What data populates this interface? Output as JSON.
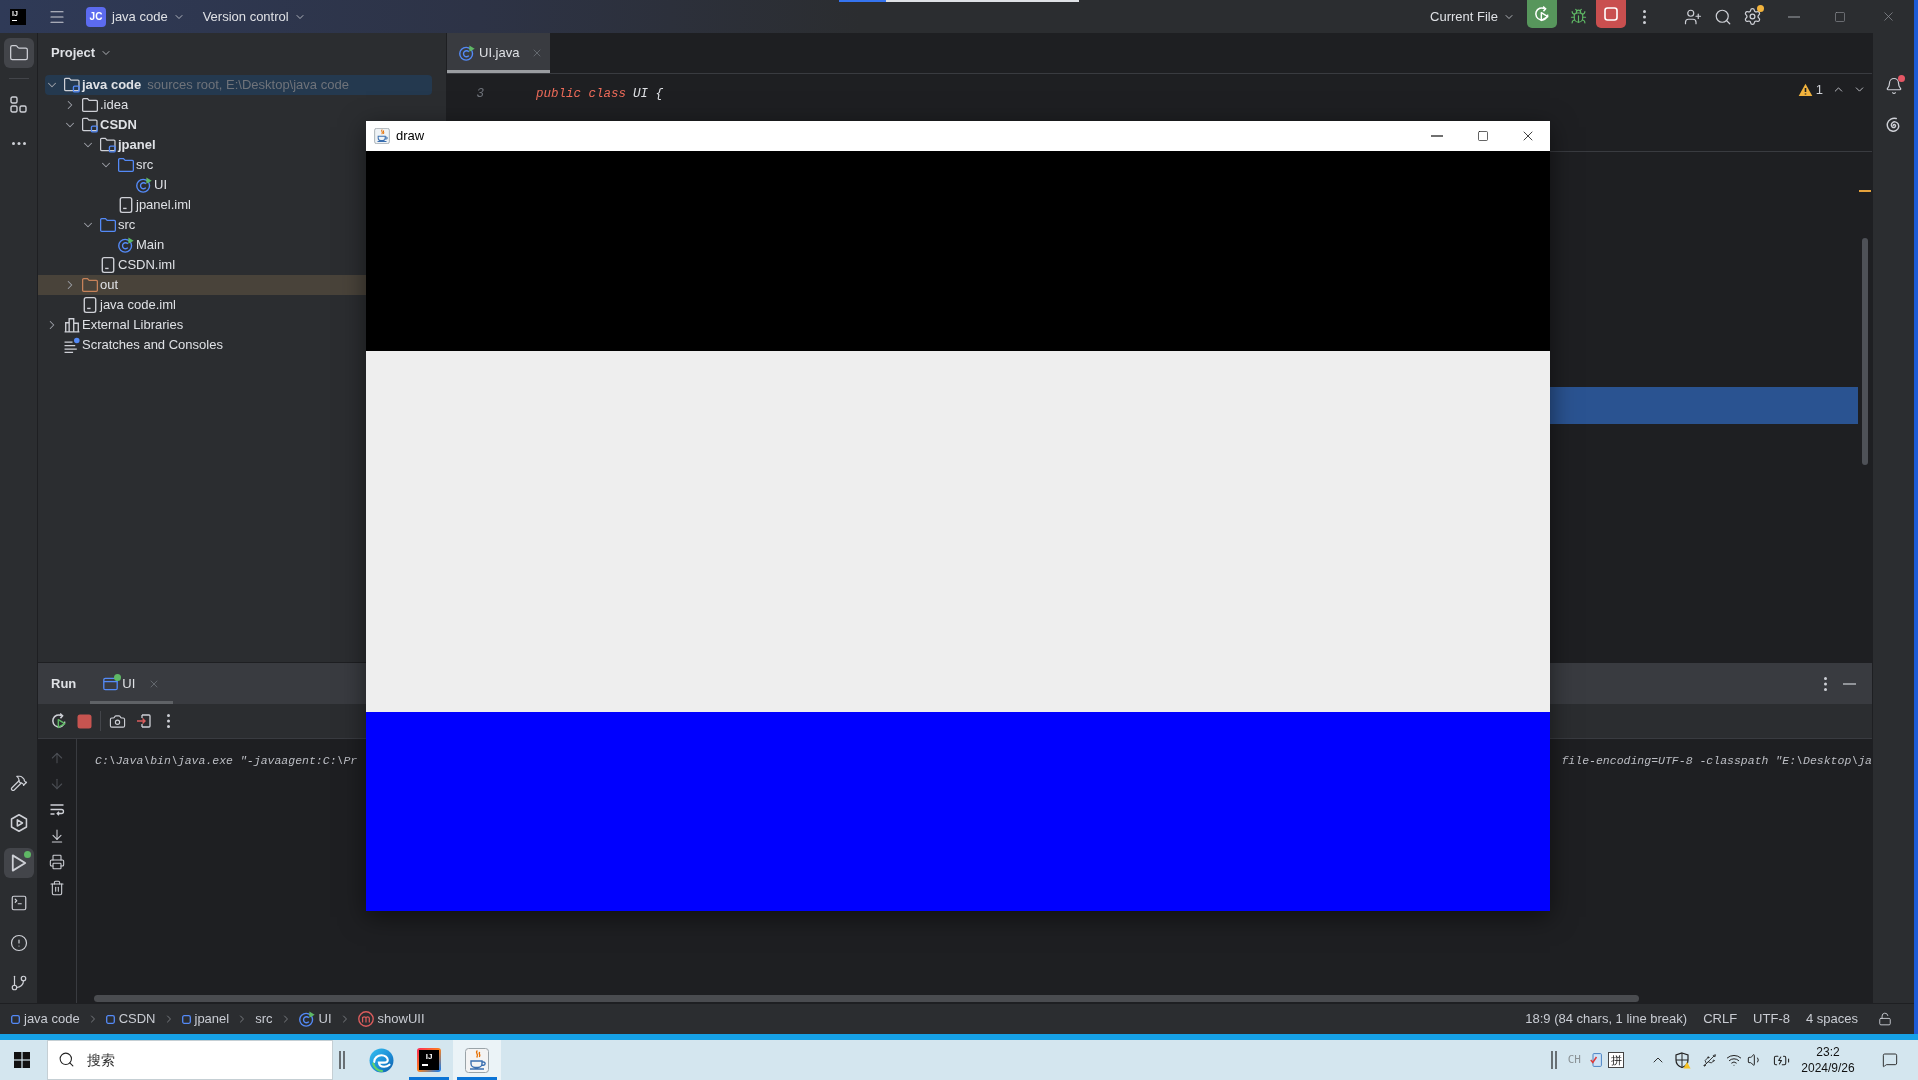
{
  "title_bar": {
    "logo": "IJ",
    "project_badge": "JC",
    "project_name": "java code",
    "vcs": "Version control",
    "run_config": "Current File",
    "settings_badge": true
  },
  "left_toolbar": {
    "top": [
      {
        "selected": true
      },
      {
        "selected": false
      },
      {
        "selected": false
      }
    ],
    "bottom": [
      {
        "selected": false,
        "running": false
      },
      {
        "selected": false,
        "running": false
      },
      {
        "selected": true,
        "running": true
      },
      {
        "selected": false,
        "running": false
      },
      {
        "selected": false,
        "running": false
      },
      {
        "selected": false,
        "running": false
      }
    ]
  },
  "right_toolbar": {
    "notifications_badge": true
  },
  "project_panel": {
    "title": "Project",
    "tree": [
      {
        "label": "java code",
        "hint": "sources root, E:\\Desktop\\java code",
        "kind": "module",
        "expanded": true,
        "selected": true,
        "children": [
          {
            "label": ".idea",
            "kind": "folder",
            "expanded": false,
            "selected": false
          },
          {
            "label": "CSDN",
            "kind": "module",
            "expanded": true,
            "selected": false,
            "children": [
              {
                "label": "jpanel",
                "kind": "module",
                "expanded": true,
                "selected": false,
                "children": [
                  {
                    "label": "src",
                    "kind": "source",
                    "expanded": true,
                    "selected": false,
                    "children": [
                      {
                        "label": "UI",
                        "kind": "class",
                        "selected": false
                      }
                    ]
                  },
                  {
                    "label": "jpanel.iml",
                    "kind": "file",
                    "selected": false
                  }
                ]
              },
              {
                "label": "src",
                "kind": "source",
                "expanded": true,
                "selected": false,
                "children": [
                  {
                    "label": "Main",
                    "kind": "class",
                    "selected": false
                  }
                ]
              },
              {
                "label": "CSDN.iml",
                "kind": "file",
                "selected": false
              }
            ]
          },
          {
            "label": "out",
            "kind": "excluded",
            "expanded": false,
            "selected": false
          },
          {
            "label": "java code.iml",
            "kind": "file",
            "selected": false
          }
        ]
      },
      {
        "label": "External Libraries",
        "kind": "libraries",
        "expanded": false,
        "selected": false
      },
      {
        "label": "Scratches and Consoles",
        "kind": "scratches",
        "selected": false
      }
    ]
  },
  "editor": {
    "tabs": [
      {
        "label": "UI.java",
        "selected": true
      }
    ],
    "sticky_line": {
      "number": "3",
      "keyword": "public class",
      "text": "UI {"
    },
    "warnings": "1"
  },
  "app_window": {
    "title": "draw",
    "panels": [
      {
        "color": "#000000"
      },
      {
        "color": "#eeeeee"
      },
      {
        "color": "#0000ff"
      }
    ]
  },
  "run_panel": {
    "title": "Run",
    "tabs": [
      {
        "label": "UI",
        "selected": true,
        "running": true
      }
    ],
    "side_tools": [
      {
        "disabled": true
      },
      {
        "disabled": true
      },
      {
        "disabled": false
      },
      {
        "disabled": false
      },
      {
        "disabled": false
      },
      {
        "disabled": false
      }
    ],
    "console": [
      "C:\\Java\\bin\\java.exe \"-javaagent:C:\\Pr",
      "file-encoding=UTF-8 -classpath \"E:\\Desktop\\ja"
    ]
  },
  "status_bar": {
    "breadcrumbs": [
      {
        "label": "java code",
        "kind": "module"
      },
      {
        "label": "CSDN",
        "kind": "module"
      },
      {
        "label": "jpanel",
        "kind": "module"
      },
      {
        "label": "src",
        "kind": "folder"
      },
      {
        "label": "UI",
        "kind": "class"
      },
      {
        "label": "showUII",
        "kind": "method"
      }
    ],
    "position": "18:9 (84 chars, 1 line break)",
    "line_separator": "CRLF",
    "encoding": "UTF-8",
    "indent": "4 spaces"
  },
  "taskbar": {
    "search_placeholder": "搜索",
    "apps": [
      {
        "selected": false,
        "running": false
      },
      {
        "logo": "IJ",
        "selected": false,
        "running": true
      },
      {
        "selected": true,
        "running": true
      }
    ],
    "tray": {
      "language": "CH",
      "input_mode": "拼",
      "time": "23:2",
      "date": "2024/9/26"
    }
  }
}
